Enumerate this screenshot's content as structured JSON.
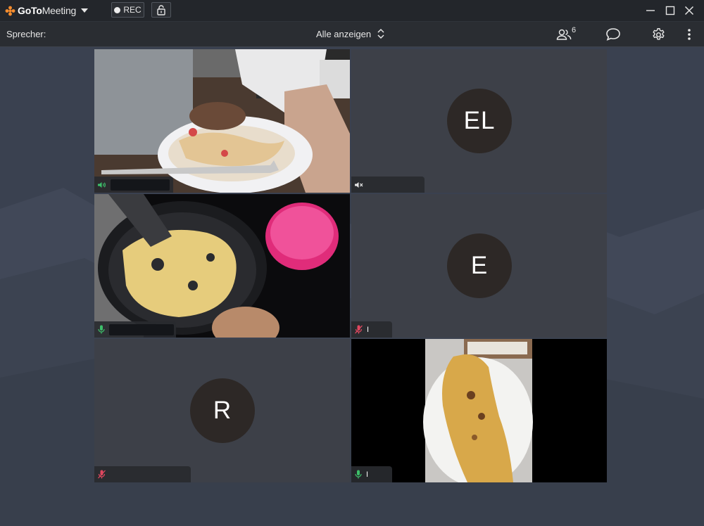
{
  "titlebar": {
    "brand_bold": "GoTo",
    "brand_light": "Meeting",
    "rec_label": "REC",
    "accent": "#f68d2e"
  },
  "toolbar": {
    "speaker_label": "Sprecher:",
    "view_label": "Alle anzeigen",
    "participant_count": "6"
  },
  "tiles": [
    {
      "kind": "video",
      "audio": "speaking",
      "name": ""
    },
    {
      "kind": "avatar",
      "initials": "EL",
      "audio": "speaker-muted",
      "name": ""
    },
    {
      "kind": "video",
      "audio": "mic-on",
      "name": ""
    },
    {
      "kind": "avatar",
      "initials": "E",
      "audio": "mic-muted",
      "name": "I"
    },
    {
      "kind": "avatar",
      "initials": "R",
      "audio": "mic-muted",
      "name": ""
    },
    {
      "kind": "video",
      "audio": "mic-on",
      "name": "I"
    }
  ],
  "icons": {
    "speaking": "speaker-wave-icon",
    "speaker_muted": "speaker-muted-icon",
    "mic_on": "microphone-icon",
    "mic_muted": "microphone-muted-icon"
  },
  "colors": {
    "mic_on": "#3dbf6a",
    "mic_muted": "#e0475f"
  }
}
